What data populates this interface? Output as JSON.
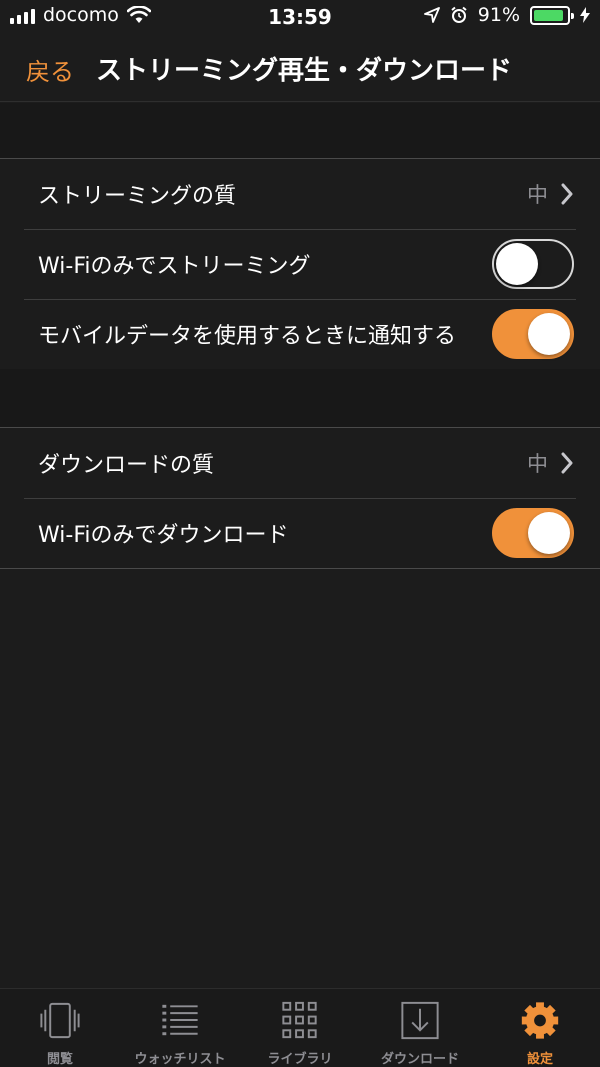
{
  "status": {
    "carrier": "docomo",
    "time": "13:59",
    "battery": "91%",
    "battery_level": 0.91
  },
  "nav": {
    "back_label": "戻る",
    "title": "ストリーミング再生・ダウンロード"
  },
  "streaming": {
    "quality_label": "ストリーミングの質",
    "quality_value": "中",
    "wifi_only_label": "Wi-Fiのみでストリーミング",
    "wifi_only_on": false,
    "notify_label": "モバイルデータを使用するときに通知する",
    "notify_on": true
  },
  "download": {
    "quality_label": "ダウンロードの質",
    "quality_value": "中",
    "wifi_only_label": "Wi-Fiのみでダウンロード",
    "wifi_only_on": true
  },
  "tabs": [
    {
      "label": "閲覧",
      "icon": "browse-icon",
      "active": false
    },
    {
      "label": "ウォッチリスト",
      "icon": "list-icon",
      "active": false
    },
    {
      "label": "ライブラリ",
      "icon": "grid-icon",
      "active": false
    },
    {
      "label": "ダウンロード",
      "icon": "download-icon",
      "active": false
    },
    {
      "label": "設定",
      "icon": "gear-icon",
      "active": true
    }
  ],
  "colors": {
    "accent": "#f0913a",
    "background": "#1c1c1c",
    "secondary_text": "#8e8e93"
  }
}
